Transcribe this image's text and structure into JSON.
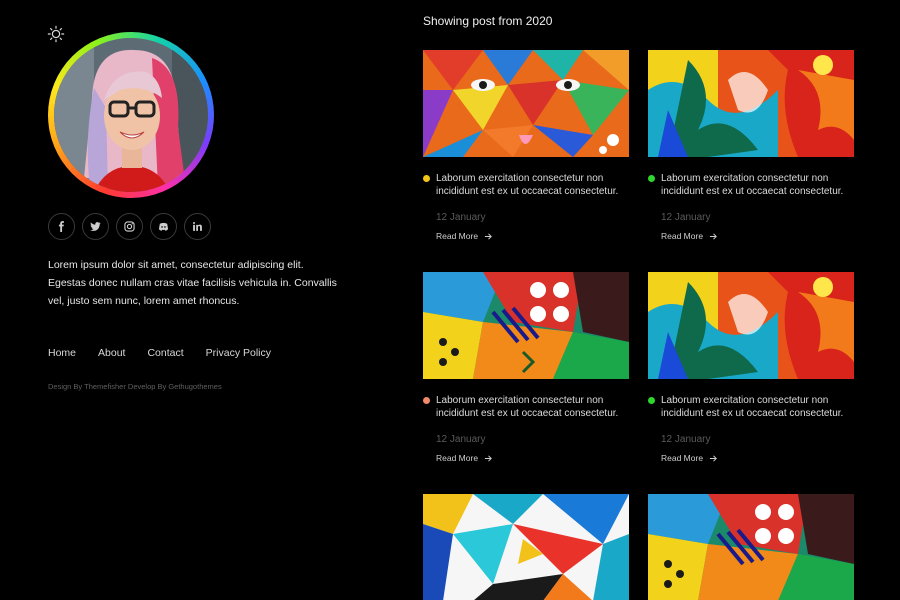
{
  "theme_toggle": {
    "icon": "sun-icon"
  },
  "profile": {
    "avatar": "avatar"
  },
  "social": [
    {
      "name": "facebook",
      "glyph": "f"
    },
    {
      "name": "twitter",
      "glyph": "t"
    },
    {
      "name": "instagram",
      "glyph": "i"
    },
    {
      "name": "discord",
      "glyph": "d"
    },
    {
      "name": "linkedin",
      "glyph": "in"
    }
  ],
  "bio": {
    "line1": "Lorem ipsum dolor sit amet, consectetur adipiscing elit.",
    "line2": "Egestas donec nullam cras vitae facilisis vehicula in. Convallis",
    "line3": "vel, justo sem nunc, lorem amet rhoncus."
  },
  "nav": [
    "Home",
    "About",
    "Contact",
    "Privacy Policy"
  ],
  "credit": "Design By Themefisher Develop By Gethugothemes",
  "heading": "Showing post from 2020",
  "posts": [
    {
      "title_line1": "Laborum exercitation consectetur non",
      "title_line2": "incididunt est ex ut occaecat consectetur.",
      "date": "12 January",
      "read_more": "Read More",
      "dot_color": "#f2c617"
    },
    {
      "title_line1": "Laborum exercitation consectetur non",
      "title_line2": "incididunt est ex ut occaecat consectetur.",
      "date": "12 January",
      "read_more": "Read More",
      "dot_color": "#2ed62e"
    },
    {
      "title_line1": "Laborum exercitation consectetur non",
      "title_line2": "incididunt est ex ut occaecat consectetur.",
      "date": "12 January",
      "read_more": "Read More",
      "dot_color": "#f08a6a"
    },
    {
      "title_line1": "Laborum exercitation consectetur non",
      "title_line2": "incididunt est ex ut occaecat consectetur.",
      "date": "12 January",
      "read_more": "Read More",
      "dot_color": "#2ed62e"
    }
  ]
}
